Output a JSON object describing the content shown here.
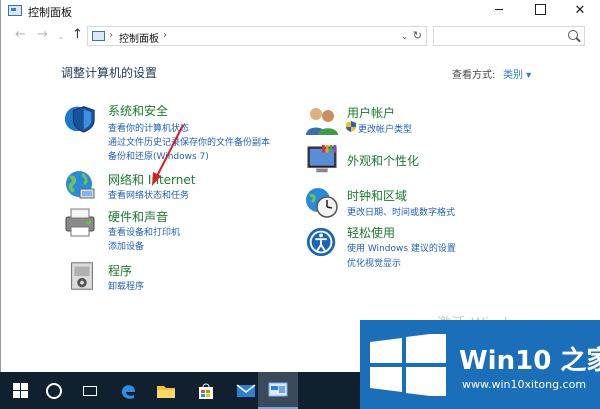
{
  "window": {
    "title": "控制面板",
    "controls": {
      "minimize": "─",
      "maximize": "",
      "close": "✕"
    }
  },
  "nav": {
    "back": "←",
    "forward": "→",
    "recent": "⌄",
    "up": "↑",
    "breadcrumb_sep": "›",
    "breadcrumb": "控制面板",
    "breadcrumb_after": "›",
    "dropdown": "⌄",
    "refresh": "↻",
    "search_placeholder": ""
  },
  "main": {
    "heading": "调整计算机的设置",
    "view_by_label": "查看方式:",
    "view_by_value": "类别 ▾",
    "categories_left": [
      {
        "icon": "shield-icon",
        "title": "系统和安全",
        "links": [
          "查看你的计算机状态",
          "通过文件历史记录保存你的文件备份副本",
          "备份和还原(Windows 7)"
        ]
      },
      {
        "icon": "network-globe-icon",
        "title": "网络和 Internet",
        "links": [
          "查看网络状态和任务"
        ]
      },
      {
        "icon": "printer-icon",
        "title": "硬件和声音",
        "links": [
          "查看设备和打印机",
          "添加设备"
        ]
      },
      {
        "icon": "programs-icon",
        "title": "程序",
        "links": [
          "卸载程序"
        ]
      }
    ],
    "categories_right": [
      {
        "icon": "users-icon",
        "title": "用户帐户",
        "links": [
          "更改帐户类型"
        ]
      },
      {
        "icon": "appearance-icon",
        "title": "外观和个性化",
        "links": []
      },
      {
        "icon": "clock-globe-icon",
        "title": "时钟和区域",
        "links": [
          "更改日期、时间或数字格式"
        ]
      },
      {
        "icon": "ease-of-access-icon",
        "title": "轻松使用",
        "links": [
          "使用 Windows 建议的设置",
          "优化视觉显示"
        ]
      }
    ],
    "watermark": "激活 Windows"
  },
  "taskbar": {
    "items": [
      "windows-start-icon",
      "cortana-icon",
      "task-view-icon",
      "edge-icon",
      "file-explorer-icon",
      "store-icon",
      "mail-icon",
      "control-panel-icon"
    ]
  },
  "brand": {
    "title": "Win10 之家",
    "url": "www.win10xitong.com"
  },
  "colors": {
    "category_title": "#1a7a2e",
    "link": "#2060b8",
    "heading": "#1e395b",
    "taskbar": "#10202f",
    "brand_bg": "#1b6fb8",
    "arrow": "#d42020"
  }
}
